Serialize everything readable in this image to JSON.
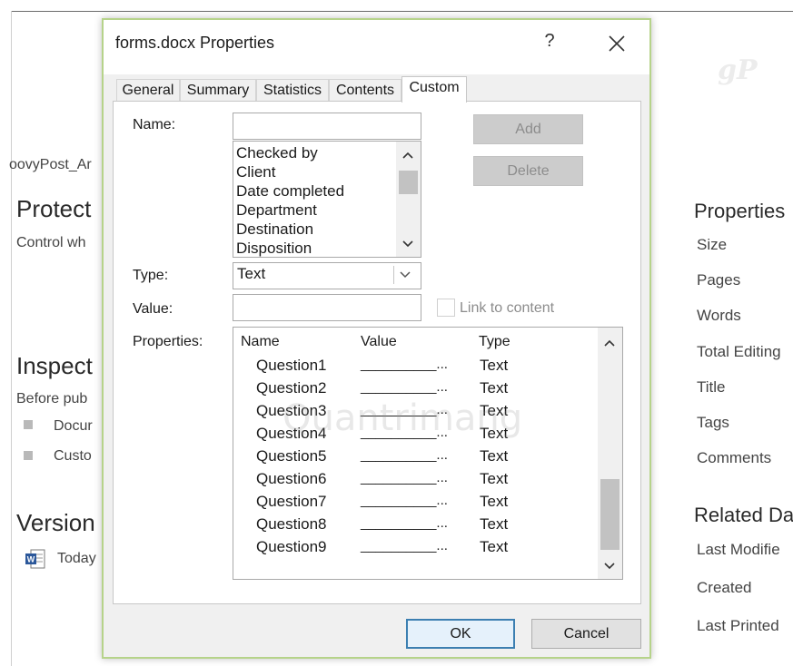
{
  "background": {
    "breadcrumb": "oovyPost_Ar",
    "protect_heading": "Protect",
    "protect_sub": "Control wh",
    "inspect_heading": "Inspect",
    "inspect_sub": "Before pub",
    "bullets": [
      "Docur",
      "Custo"
    ],
    "versions_heading": "Version",
    "version_item": "Today",
    "properties_heading": "Properties",
    "properties": [
      "Size",
      "Pages",
      "Words",
      "Total Editing",
      "Title",
      "Tags",
      "Comments"
    ],
    "related_heading": "Related Da",
    "related": [
      "Last Modifie",
      "Created",
      "Last Printed"
    ],
    "watermark_gp": "gP"
  },
  "dialog": {
    "title": "forms.docx Properties",
    "help_glyph": "?",
    "tabs": [
      "General",
      "Summary",
      "Statistics",
      "Contents",
      "Custom"
    ],
    "active_tab": "Custom",
    "name_label": "Name:",
    "name_value": "",
    "name_list": [
      "Checked by",
      "Client",
      "Date completed",
      "Department",
      "Destination",
      "Disposition"
    ],
    "add_label": "Add",
    "delete_label": "Delete",
    "type_label": "Type:",
    "type_value": "Text",
    "value_label": "Value:",
    "value_value": "",
    "link_label": "Link to content",
    "link_checked": false,
    "properties_label": "Properties:",
    "table_headers": [
      "Name",
      "Value",
      "Type"
    ],
    "rows": [
      {
        "name": "Question1",
        "value": "__________...",
        "type": "Text"
      },
      {
        "name": "Question2",
        "value": "__________...",
        "type": "Text"
      },
      {
        "name": "Question3",
        "value": "__________...",
        "type": "Text"
      },
      {
        "name": "Question4",
        "value": "__________...",
        "type": "Text"
      },
      {
        "name": "Question5",
        "value": "__________...",
        "type": "Text"
      },
      {
        "name": "Question6",
        "value": "__________...",
        "type": "Text"
      },
      {
        "name": "Question7",
        "value": "__________...",
        "type": "Text"
      },
      {
        "name": "Question8",
        "value": "__________...",
        "type": "Text"
      },
      {
        "name": "Question9",
        "value": "__________...",
        "type": "Text"
      }
    ],
    "ok_label": "OK",
    "cancel_label": "Cancel",
    "watermark": "Quantrimang"
  },
  "colors": {
    "dialog_border": "#b6d38a",
    "default_button_border": "#3c7fb1",
    "disabled_button": "#cccccc"
  }
}
